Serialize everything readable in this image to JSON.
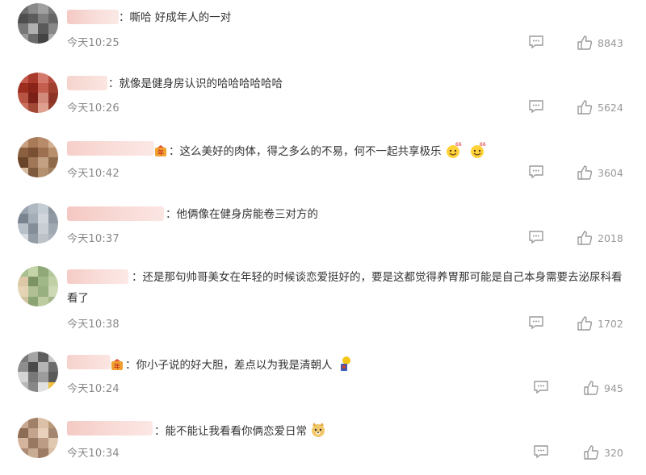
{
  "comments": [
    {
      "text": "：嘶哈 好成年人的一对",
      "time": "今天10:25",
      "likes": "8843"
    },
    {
      "text": "：就像是健身房认识的哈哈哈哈哈哈",
      "time": "今天10:26",
      "likes": "5624"
    },
    {
      "text": "：这么美好的肉体，得之多么的不易，何不一起共享极乐",
      "time": "今天10:42",
      "likes": "3604"
    },
    {
      "text": "：他俩像在健身房能卷三对方的",
      "time": "今天10:37",
      "likes": "2018"
    },
    {
      "text": "：还是那句帅哥美女在年轻的时候谈恋爱挺好的，要是这都觉得养胃那可能是自己本身需要去泌尿科看看了",
      "time": "今天10:38",
      "likes": "1702"
    },
    {
      "text": "：你小子说的好大胆，差点以为我是清朝人",
      "time": "今天10:24",
      "likes": "945"
    },
    {
      "text": "：能不能让我看看你俩恋爱日常",
      "time": "今天10:34",
      "likes": "320"
    }
  ],
  "colors": {
    "time": "#888888",
    "count": "#999999",
    "icon": "#9a9a9a"
  }
}
